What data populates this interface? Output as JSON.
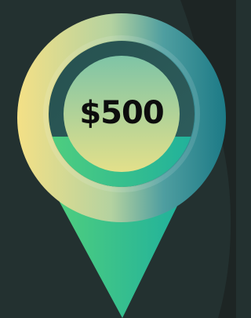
{
  "price_label": "$500",
  "icon": "location-pin-icon",
  "colors": {
    "background": "#233130",
    "background_shadow": "#1d2524",
    "ring_left": "#f4e086",
    "ring_right": "#1c7a86",
    "inner_disc_top": "#7ec4a6",
    "inner_disc_bottom": "#e3e08a",
    "pin_left": "#4fce7e",
    "pin_right": "#20b19c",
    "text": "#0d0d0d"
  }
}
